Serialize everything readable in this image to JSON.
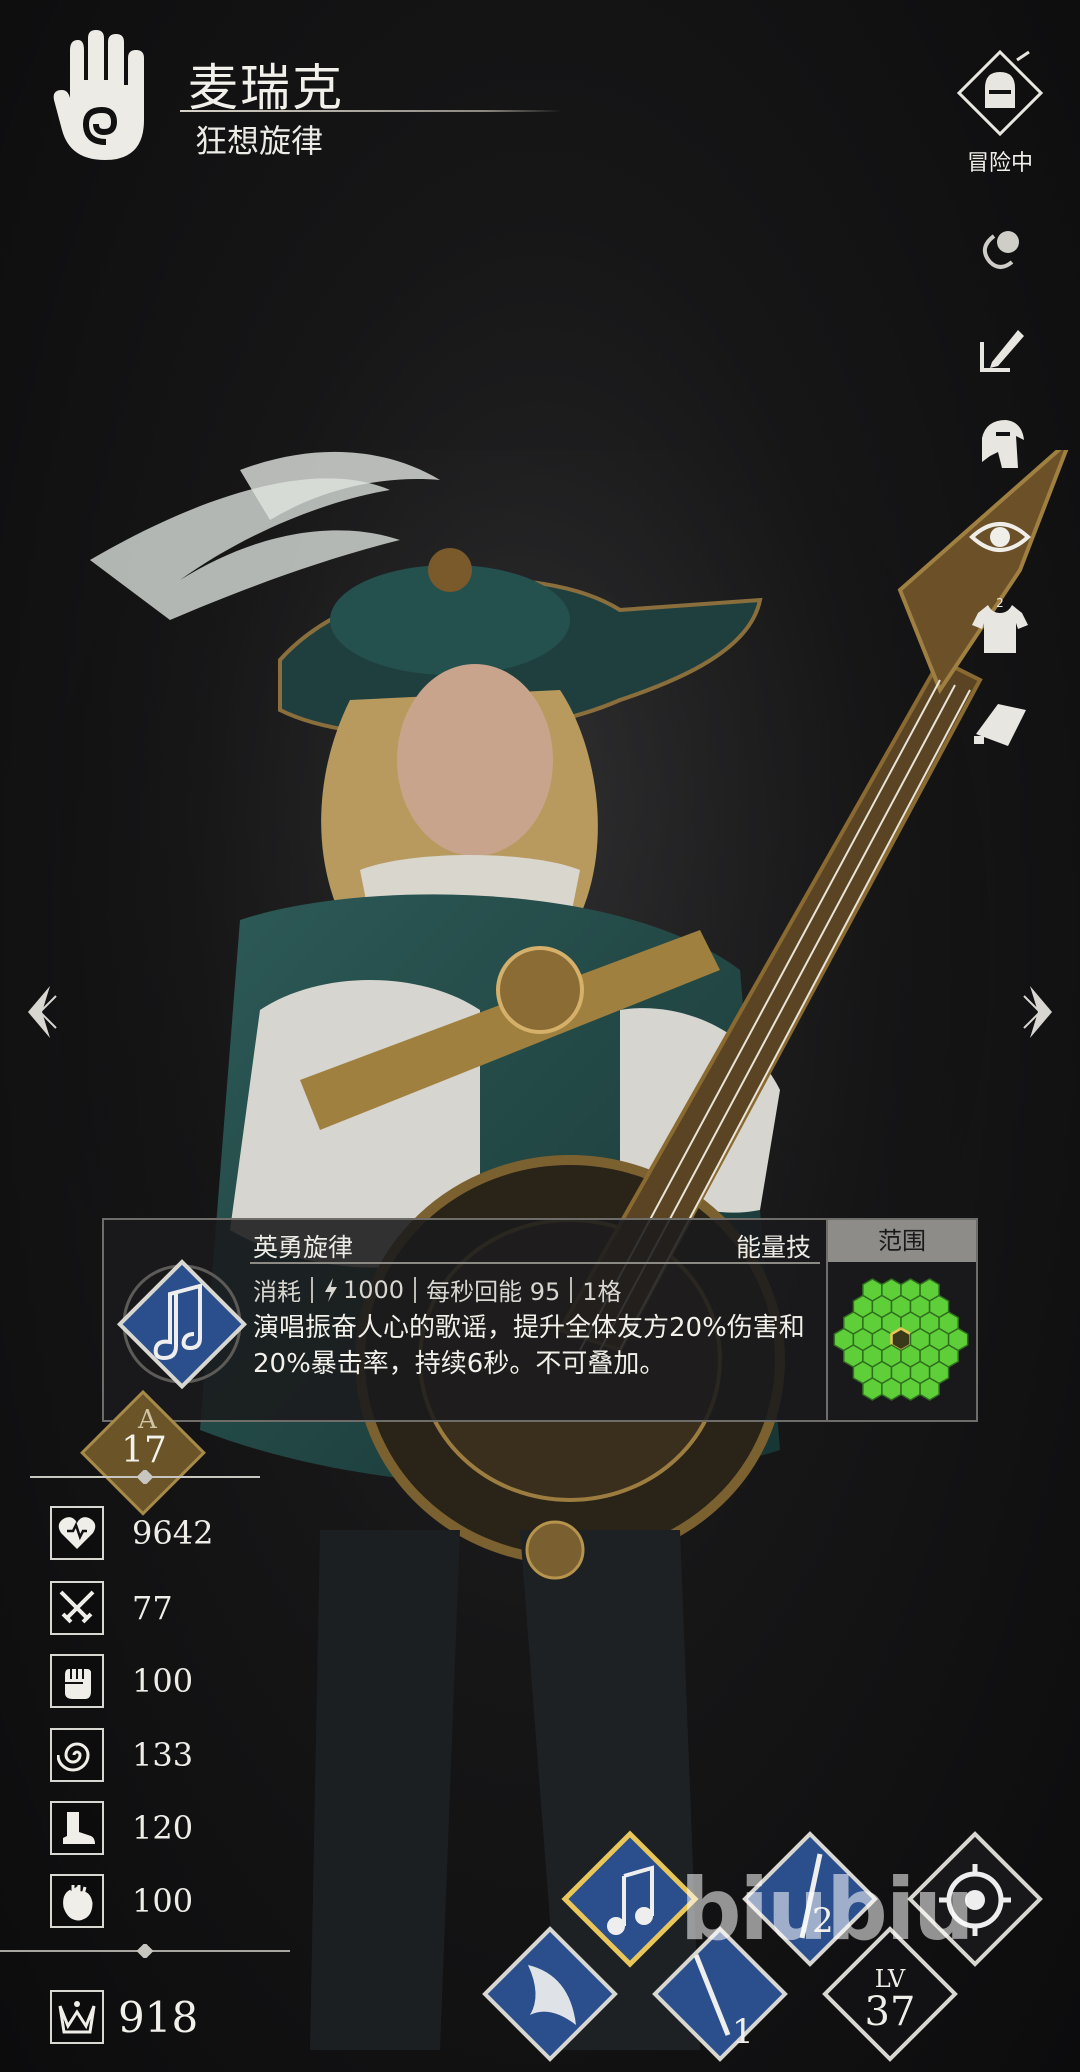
{
  "header": {
    "name": "麦瑞克",
    "subclass": "狂想旋律",
    "class_emblem_icon": "hand-spiral-icon"
  },
  "side_menu": {
    "adventure_label": "冒险中",
    "adventure_icon": "knight-helmet-icon",
    "items": [
      {
        "icon": "link-icon"
      },
      {
        "icon": "edit-icon"
      },
      {
        "icon": "helmet-icon"
      },
      {
        "icon": "eye-icon"
      },
      {
        "icon": "outfit-icon",
        "badge": "2"
      },
      {
        "icon": "tag-icon"
      }
    ]
  },
  "skill": {
    "name": "英勇旋律",
    "type": "能量技",
    "cost_label": "消耗",
    "cost_value": "1000",
    "regen": "每秒回能 95",
    "slots": "1格",
    "description": "演唱振奋人心的歌谣，提升全体友方20%伤害和20%暴击率，持续6秒。不可叠加。",
    "range_label": "范围",
    "icon": "music-note-icon"
  },
  "level": {
    "value": "17",
    "rank_letter": "A"
  },
  "stats": [
    {
      "icon": "heart-icon",
      "value": "9642"
    },
    {
      "icon": "crossed-swords-icon",
      "value": "77"
    },
    {
      "icon": "fist-icon",
      "value": "100"
    },
    {
      "icon": "swirl-icon",
      "value": "133"
    },
    {
      "icon": "boot-icon",
      "value": "120"
    },
    {
      "icon": "anatomical-heart-icon",
      "value": "100"
    }
  ],
  "power": {
    "icon": "crown-icon",
    "value": "918"
  },
  "skill_slots": {
    "slot_1_label": "1",
    "slot_2_label": "2",
    "lv_label": "LV",
    "lv_value": "37"
  },
  "watermark": "biubiu",
  "colors": {
    "accent_gold": "#c9a24a",
    "range_green": "#5fcf39",
    "skill_blue": "#2b4f8c"
  }
}
